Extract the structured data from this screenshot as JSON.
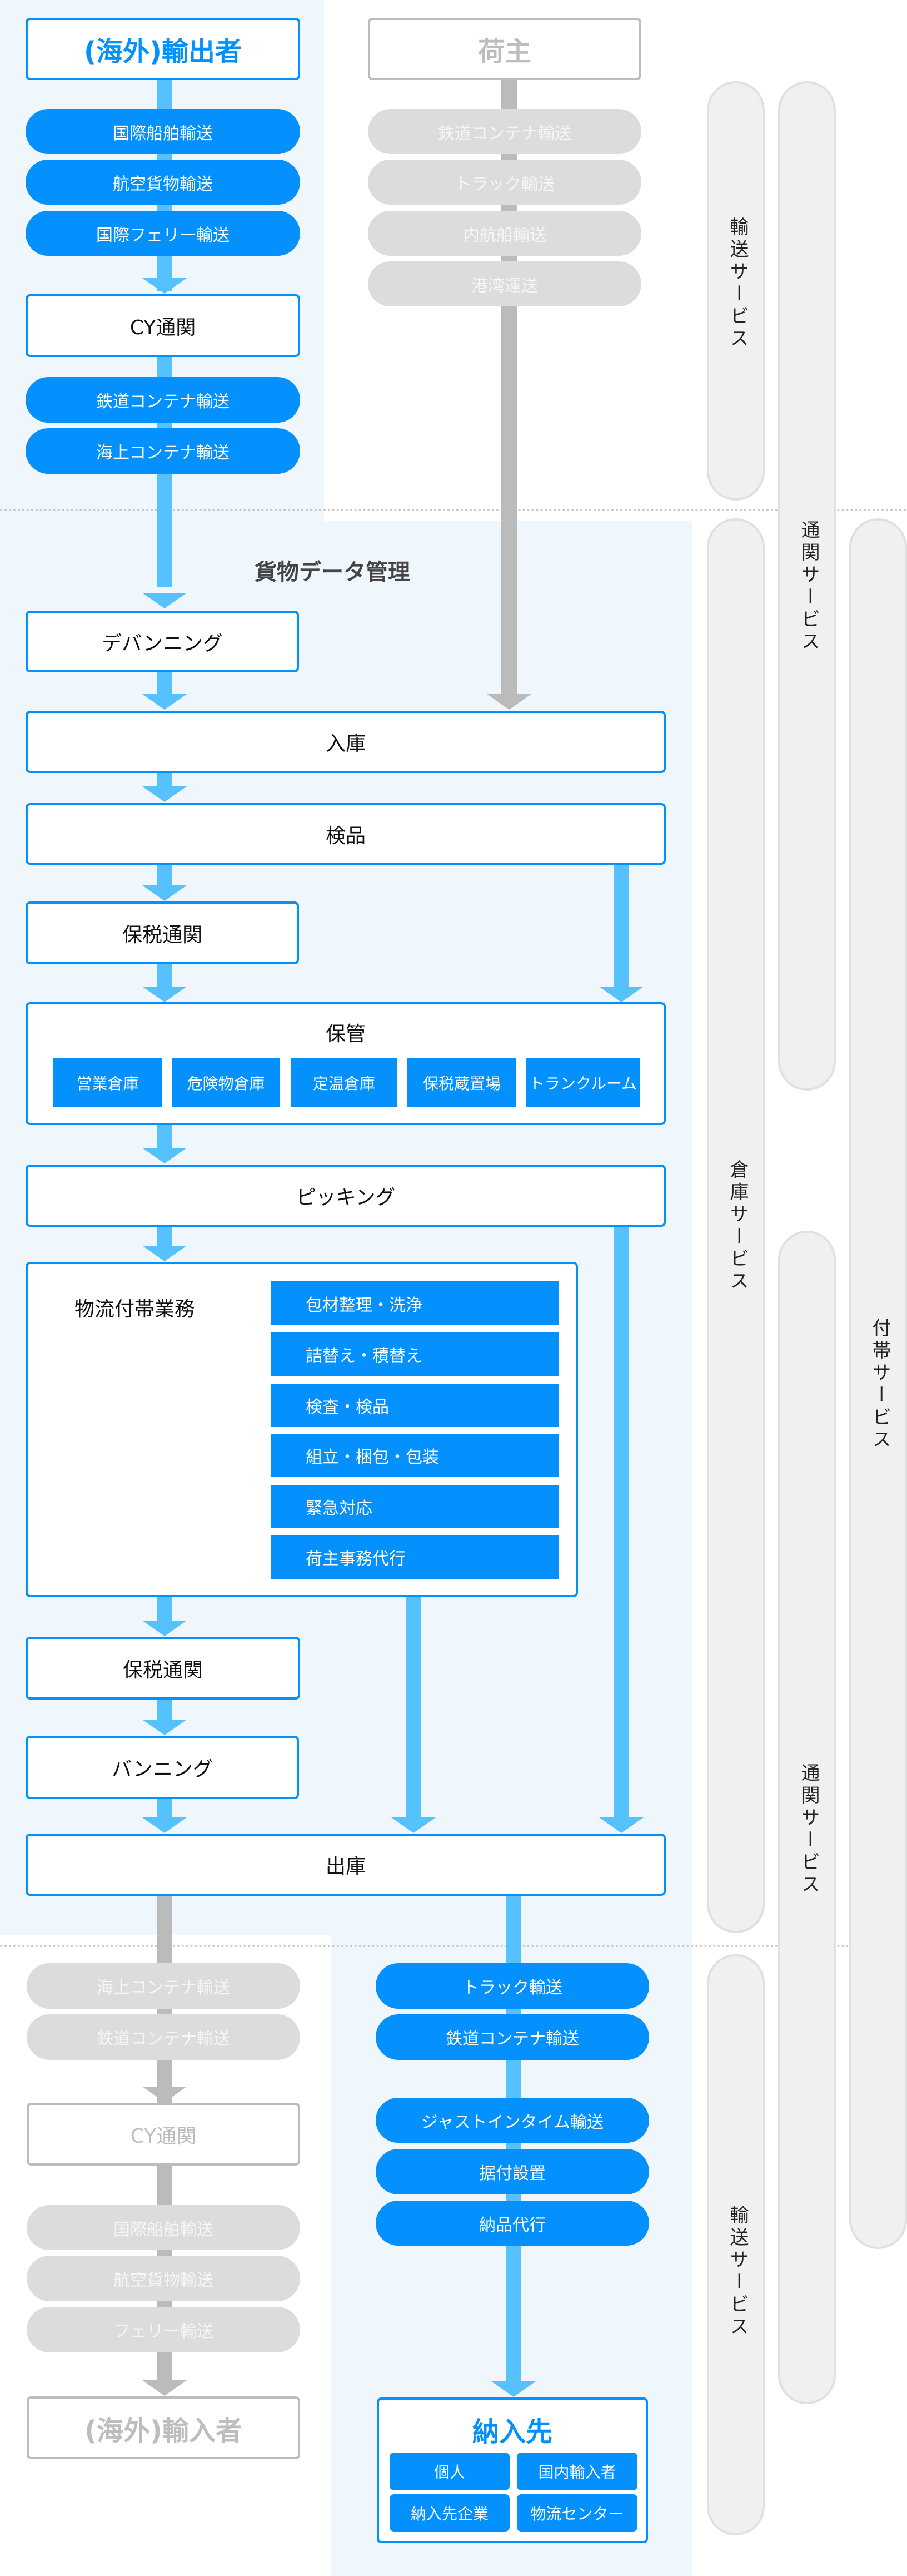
{
  "colors": {
    "accent": "#0591fd",
    "connector": "#56c2fd",
    "inactive": "#bbbbbb",
    "section_bg": "#eff7fd"
  },
  "origin": {
    "exporter": "(海外)輸出者",
    "exporter_routes": [
      "国際船舶輸送",
      "航空貨物輸送",
      "国際フェリー輸送"
    ],
    "cy_customs": "CY通関",
    "exporter_inland": [
      "鉄道コンテナ輸送",
      "海上コンテナ輸送"
    ],
    "shipper": "荷主",
    "shipper_routes": [
      "鉄道コンテナ輸送",
      "トラック輸送",
      "内航船輸送",
      "港湾運送"
    ]
  },
  "warehouse": {
    "cargo_data_title": "貨物データ管理",
    "devanning": "デバンニング",
    "receiving": "入庫",
    "inspection": "検品",
    "bonded_customs_1": "保税通関",
    "storage": "保管",
    "storage_types": [
      "営業倉庫",
      "危険物倉庫",
      "定温倉庫",
      "保税蔵置場",
      "トランクルーム"
    ],
    "picking": "ピッキング",
    "ancillary_title": "物流付帯業務",
    "ancillary_items": [
      "包材整理・洗浄",
      "詰替え・積替え",
      "検査・検品",
      "組立・梱包・包装",
      "緊急対応",
      "荷主事務代行"
    ],
    "bonded_customs_2": "保税通関",
    "vanning": "バンニング",
    "shipping_out": "出庫"
  },
  "outbound": {
    "export_routes": [
      "海上コンテナ輸送",
      "鉄道コンテナ輸送"
    ],
    "cy_customs": "CY通関",
    "export_intl_routes": [
      "国際船舶輸送",
      "航空貨物輸送",
      "フェリー輸送"
    ],
    "importer": "(海外)輸入者",
    "domestic_routes": [
      "トラック輸送",
      "鉄道コンテナ輸送"
    ],
    "domestic_services": [
      "ジャストインタイム輸送",
      "据付設置",
      "納品代行"
    ],
    "destination": "納入先",
    "destination_types": [
      "個人",
      "国内輸入者",
      "納入先企業",
      "物流センター"
    ]
  },
  "services": {
    "transport_top": "輸送サービス",
    "customs_top": "通関サービス",
    "warehouse": "倉庫サービス",
    "customs_bottom": "通関サービス",
    "ancillary": "付帯サービス",
    "transport_bottom": "輸送サービス"
  }
}
